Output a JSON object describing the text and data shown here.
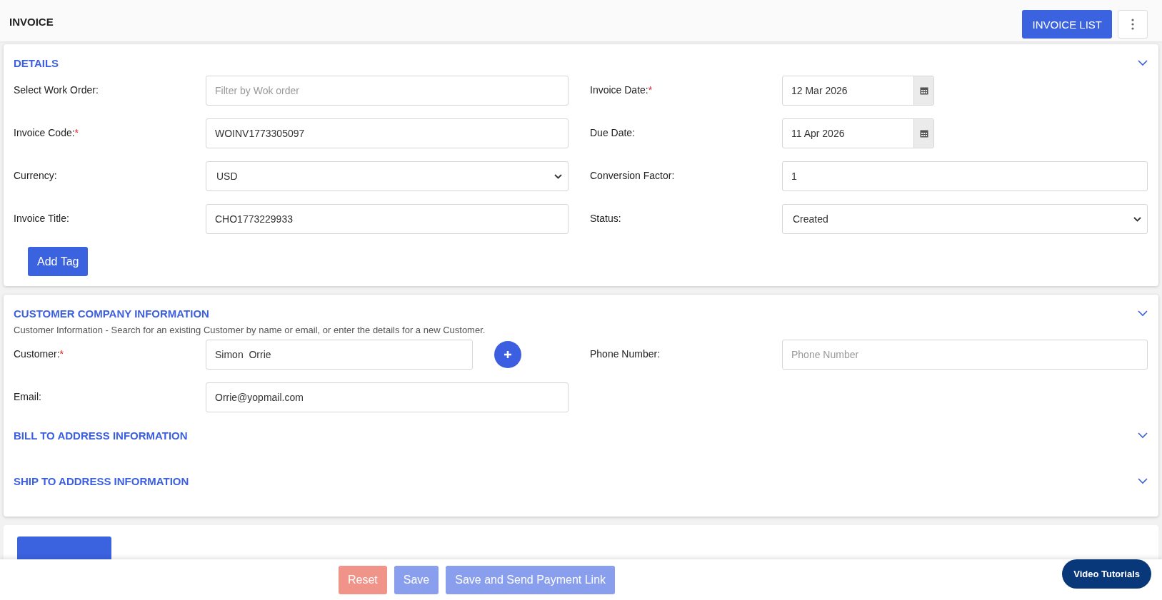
{
  "header": {
    "title": "INVOICE",
    "list_button": "INVOICE LIST"
  },
  "details": {
    "title": "DETAILS",
    "rows": [
      {
        "left": {
          "label": "Select Work Order:",
          "kind": "text",
          "placeholder": "Filter by Wok order"
        },
        "right": {
          "label": "Invoice Date:",
          "marker": "*",
          "kind": "date",
          "value": "12 Mar 2026"
        }
      },
      {
        "left": {
          "label": "Invoice Code:",
          "marker": "*",
          "kind": "text",
          "value": "WOINV1773305097"
        },
        "right": {
          "label": "Due Date:",
          "kind": "date",
          "value": "11 Apr 2026"
        }
      },
      {
        "left": {
          "label": "Currency:",
          "kind": "select",
          "value": "USD"
        },
        "right": {
          "label": "Conversion Factor:",
          "kind": "text",
          "value": "1"
        }
      },
      {
        "left": {
          "label": "Invoice Title:",
          "kind": "text",
          "value": "CHO1773229933"
        },
        "right": {
          "label": "Status:",
          "kind": "select",
          "value": "Created"
        }
      }
    ],
    "tag_button": "Add Tag"
  },
  "customer": {
    "title": "CUSTOMER COMPANY INFORMATION",
    "description": "Customer Information - Search for an existing Customer by name or email, or enter the details for a new Customer.",
    "rows": [
      {
        "left": {
          "label": "Customer:",
          "marker": "*",
          "kind": "add",
          "value": "Simon  Orrie"
        },
        "right": {
          "label": "Phone Number:",
          "kind": "text",
          "placeholder": "Phone Number"
        }
      },
      {
        "left": {
          "label": "Email:",
          "kind": "text",
          "value": "Orrie@yopmail.com"
        }
      }
    ],
    "subsections": [
      "BILL TO ADDRESS INFORMATION",
      "SHIP TO ADDRESS INFORMATION"
    ]
  },
  "footer": {
    "buttons": [
      {
        "label": "Reset",
        "kind": "reset",
        "disabled": true
      },
      {
        "label": "Save",
        "kind": "primary",
        "disabled": true
      },
      {
        "label": "Save and Send Payment Link",
        "kind": "primary",
        "disabled": true
      }
    ],
    "help_button": "Video Tutorials"
  }
}
